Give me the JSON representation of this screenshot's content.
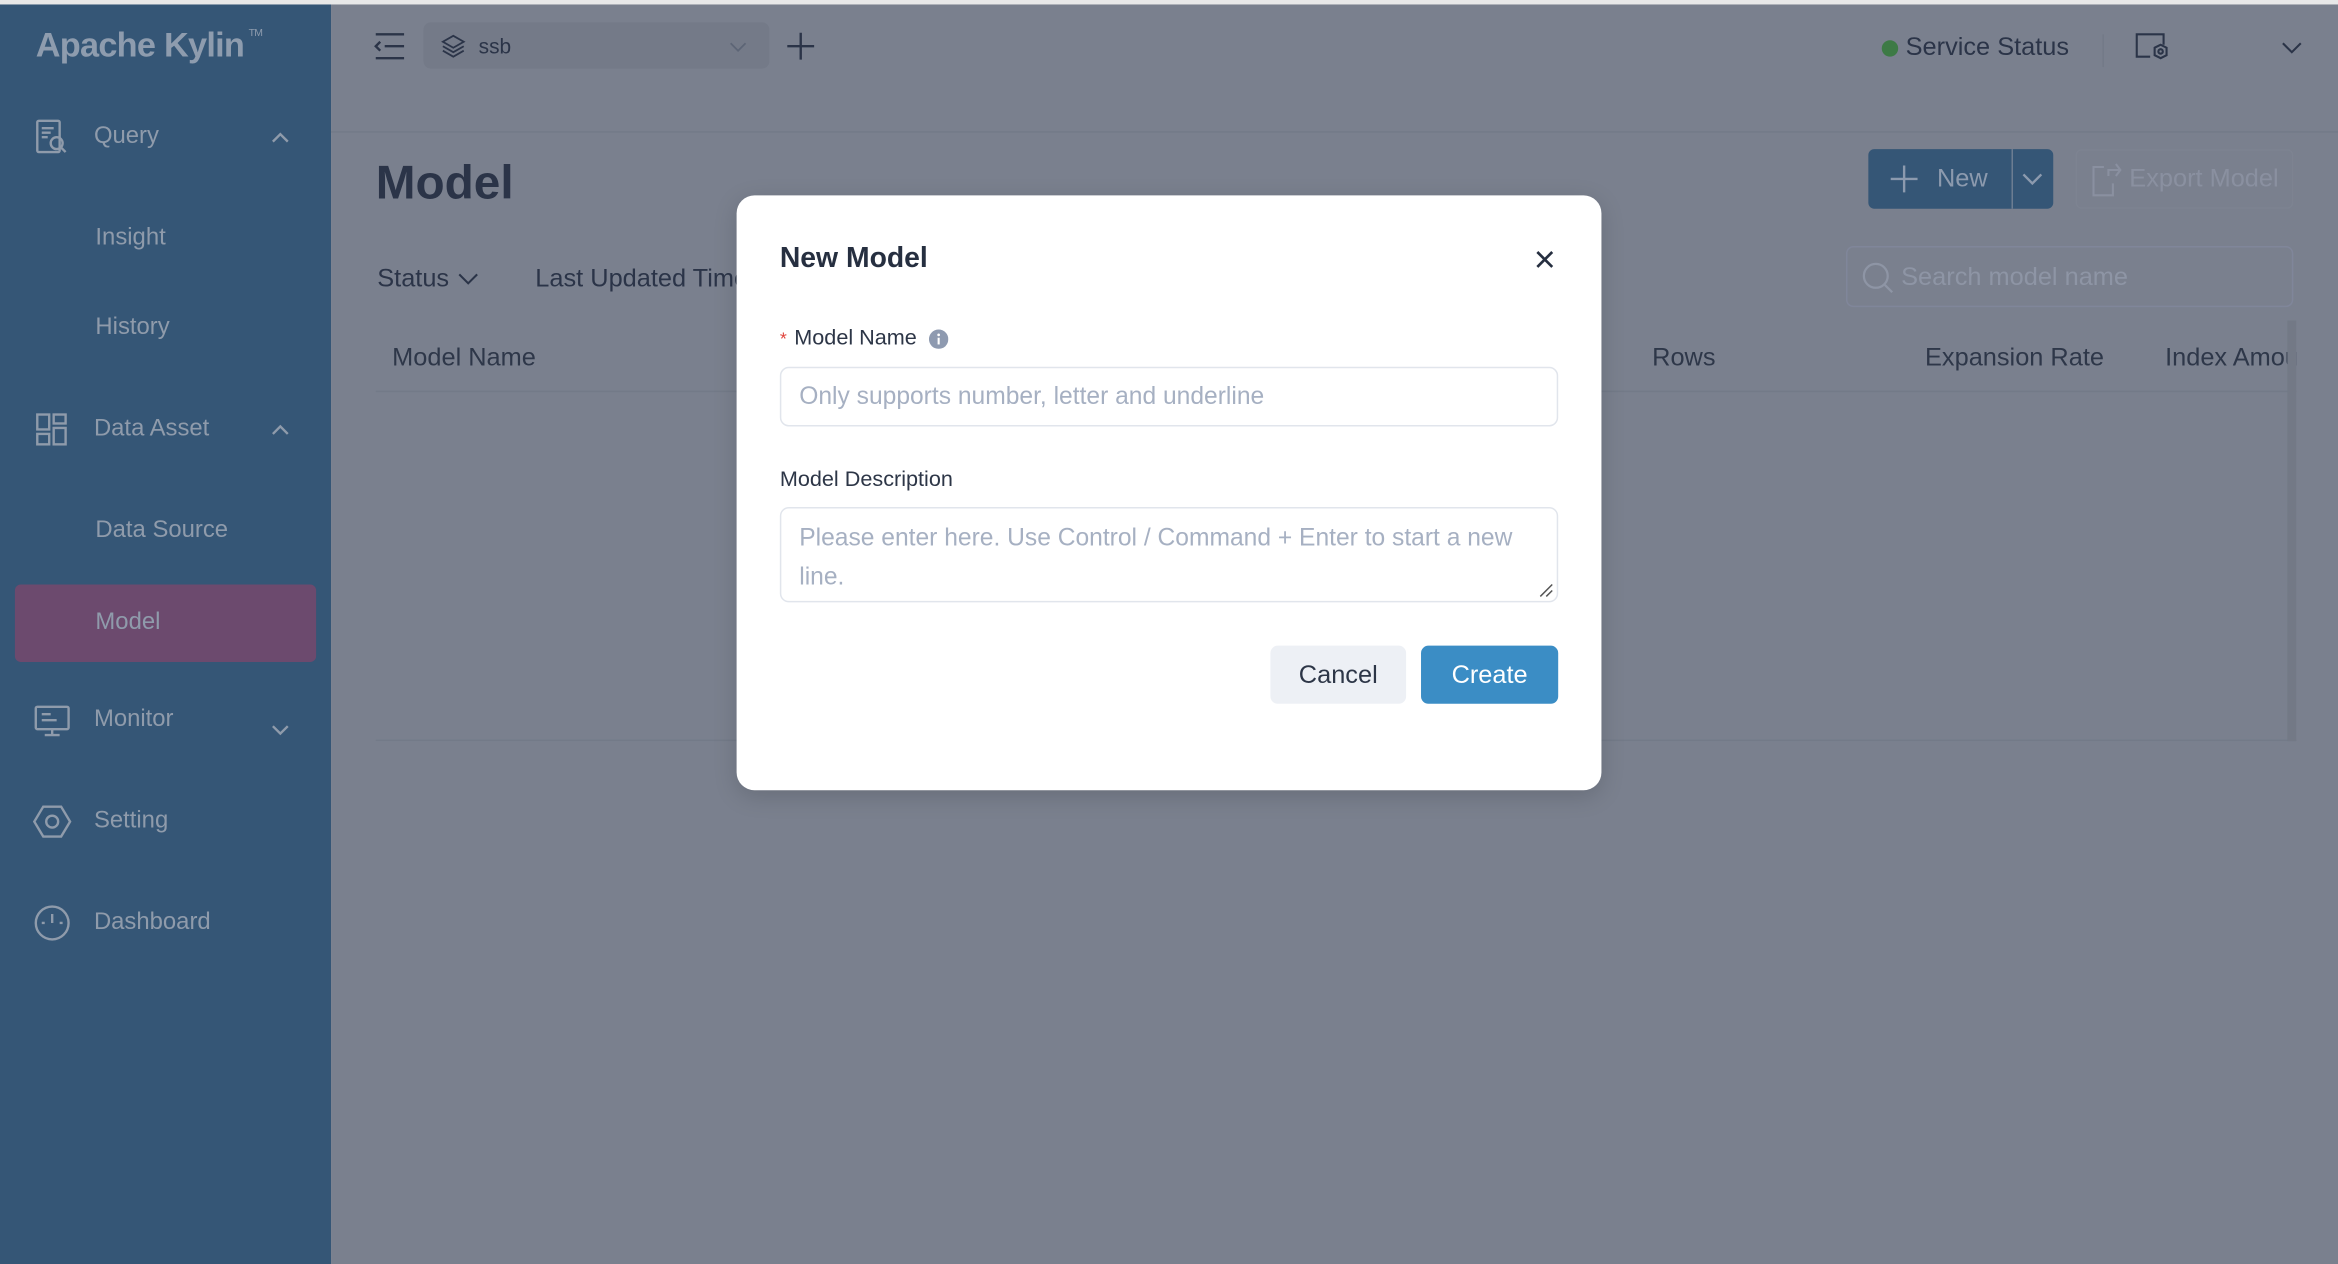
{
  "app": {
    "logo": "Apache Kylin",
    "trademark": "TM"
  },
  "sidebar": {
    "items": [
      {
        "label": "Query",
        "icon": "query-icon",
        "expanded": true
      },
      {
        "label": "Insight"
      },
      {
        "label": "History"
      },
      {
        "label": "Data Asset",
        "icon": "data-asset-icon",
        "expanded": true
      },
      {
        "label": "Data Source"
      },
      {
        "label": "Model",
        "active": true
      },
      {
        "label": "Monitor",
        "icon": "monitor-icon",
        "expanded": false
      },
      {
        "label": "Setting",
        "icon": "setting-icon"
      },
      {
        "label": "Dashboard",
        "icon": "dashboard-icon"
      }
    ]
  },
  "header": {
    "project": "ssb",
    "service_status": "Service Status",
    "status_color": "#3d7a45"
  },
  "page": {
    "title": "Model",
    "filters": [
      "Status",
      "Last Updated Time"
    ],
    "new_label": "New",
    "export_label": "Export Model",
    "search_placeholder": "Search model name",
    "columns": [
      "Model Name",
      "Rows",
      "Expansion Rate",
      "Index Amou"
    ]
  },
  "modal": {
    "title": "New Model",
    "name_label": "Model Name",
    "required_mark": "*",
    "name_placeholder": "Only supports number, letter and underline",
    "desc_label": "Model Description",
    "desc_placeholder": "Please enter here. Use Control / Command + Enter to start a new line.",
    "cancel": "Cancel",
    "create": "Create"
  },
  "colors": {
    "sidebar": "#355676",
    "active": "#6c4a6e",
    "primary": "#3b8dc5"
  }
}
